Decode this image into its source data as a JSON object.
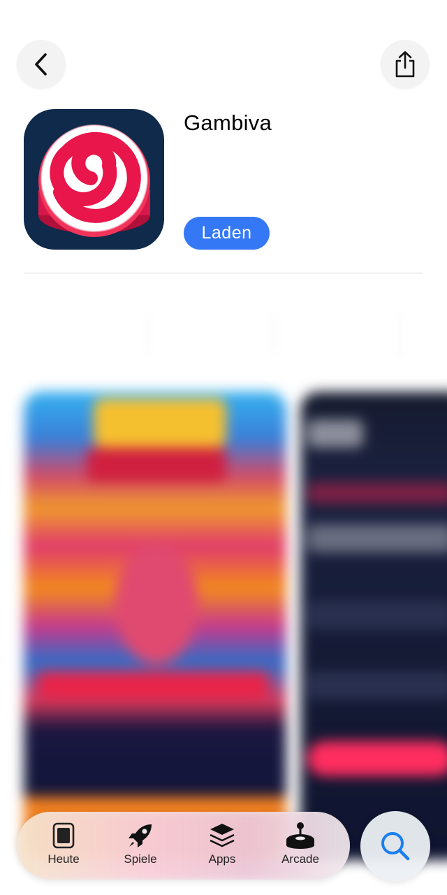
{
  "header": {
    "back_icon": "chevron-left-icon",
    "share_icon": "share-icon"
  },
  "app": {
    "name": "Gambiva",
    "get_label": "Laden",
    "accent_color": "#3478f6",
    "icon_bg": "#0f2a4a"
  },
  "tabbar": {
    "tabs": [
      {
        "label": "Heute",
        "icon": "today-icon"
      },
      {
        "label": "Spiele",
        "icon": "rocket-icon"
      },
      {
        "label": "Apps",
        "icon": "apps-stack-icon"
      },
      {
        "label": "Arcade",
        "icon": "joystick-icon"
      }
    ],
    "search_icon": "search-icon"
  }
}
